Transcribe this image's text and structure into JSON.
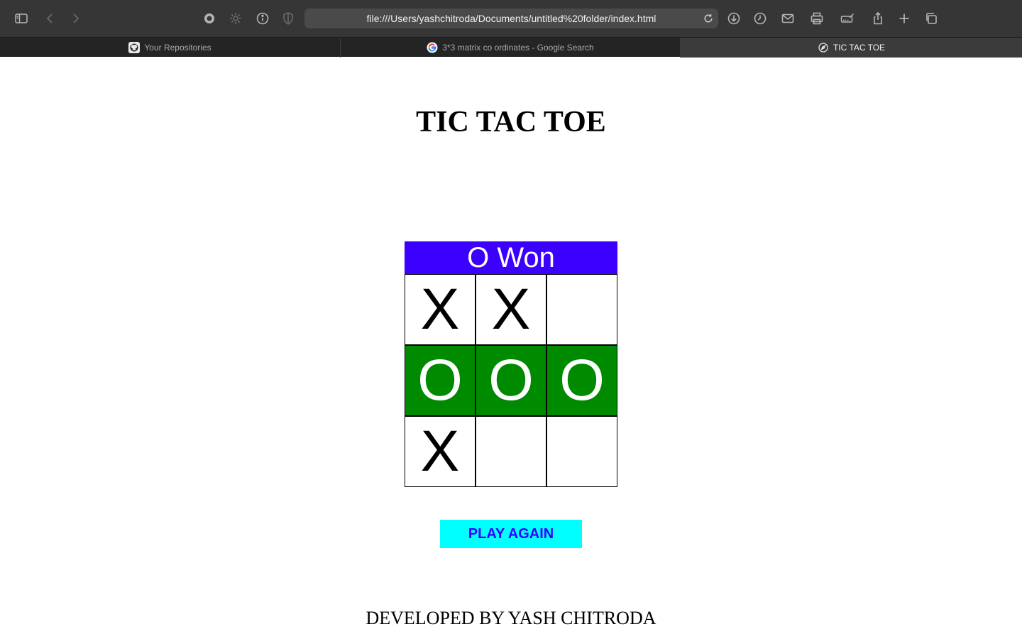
{
  "browser": {
    "url": "file:///Users/yashchitroda/Documents/untitled%20folder/index.html",
    "toolbar_icons": [
      "sidebar-icon",
      "back-icon",
      "forward-icon",
      "record-icon",
      "gear-icon",
      "info-icon",
      "shield-icon",
      "reload-icon",
      "download-icon",
      "history-icon",
      "mail-icon",
      "print-icon",
      "markup-icon",
      "share-icon",
      "new-tab-icon",
      "tab-overview-icon"
    ],
    "tabs": [
      {
        "label": "Your Repositories",
        "icon": "github-icon",
        "active": false
      },
      {
        "label": "3*3 matrix co ordinates - Google Search",
        "icon": "google-icon",
        "active": false
      },
      {
        "label": "TIC TAC TOE",
        "icon": "compass-icon",
        "active": true
      }
    ]
  },
  "page": {
    "title": "TIC TAC TOE",
    "status": "O Won",
    "board": [
      [
        "X",
        "X",
        ""
      ],
      [
        "O",
        "O",
        "O"
      ],
      [
        "X",
        "",
        ""
      ]
    ],
    "winning_row": 1,
    "play_again_label": "PLAY AGAIN",
    "footer": "DEVELOPED BY YASH CHITRODA",
    "colors": {
      "status_bg": "#3c00ff",
      "win_bg": "#008a00",
      "button_bg": "#00ffff",
      "button_text": "#3300ff"
    }
  }
}
